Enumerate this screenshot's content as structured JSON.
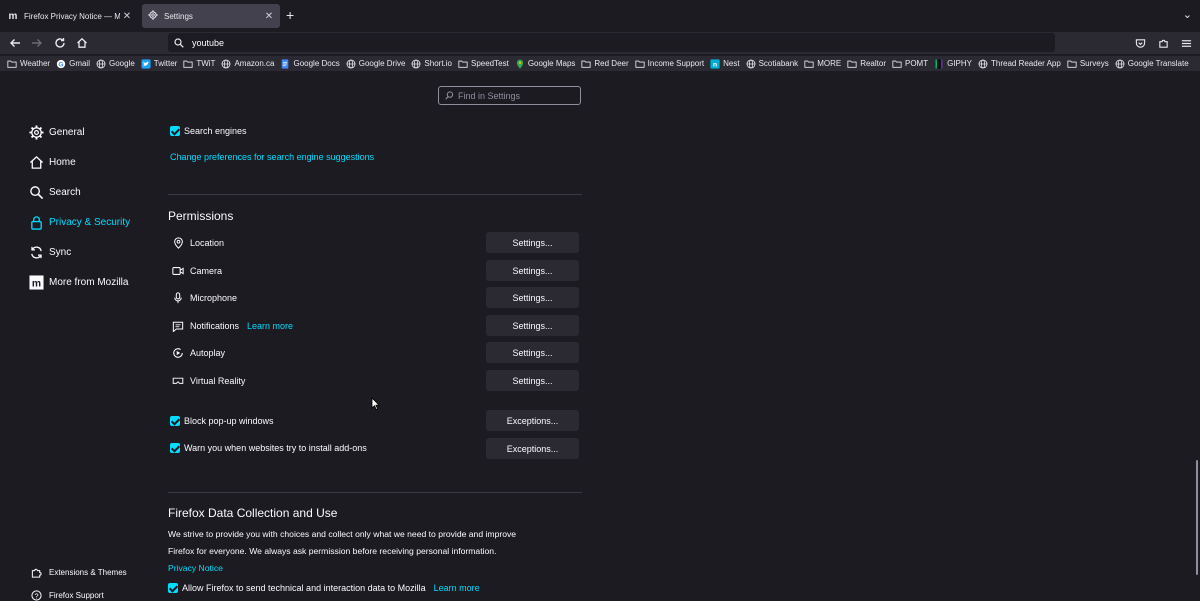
{
  "tabs": [
    {
      "title": "Firefox Privacy Notice — Mozilla",
      "favicon": "m",
      "state": "inactive"
    },
    {
      "title": "Settings",
      "favicon": "gear-icon",
      "state": "active"
    }
  ],
  "nav": {
    "url_text": "youtube"
  },
  "bookmarks": [
    {
      "label": "Weather",
      "icon": "folder-icon"
    },
    {
      "label": "Gmail",
      "icon": "google-icon"
    },
    {
      "label": "Google",
      "icon": "globe-icon"
    },
    {
      "label": "Twitter",
      "icon": "twitter-icon"
    },
    {
      "label": "TWiT",
      "icon": "folder-icon"
    },
    {
      "label": "Amazon.ca",
      "icon": "globe-icon"
    },
    {
      "label": "Google Docs",
      "icon": "docs-icon"
    },
    {
      "label": "Google Drive",
      "icon": "globe-icon"
    },
    {
      "label": "Short.io",
      "icon": "globe-icon"
    },
    {
      "label": "SpeedTest",
      "icon": "folder-icon"
    },
    {
      "label": "Google Maps",
      "icon": "maps-icon"
    },
    {
      "label": "Red Deer",
      "icon": "folder-icon"
    },
    {
      "label": "Income Support",
      "icon": "folder-icon"
    },
    {
      "label": "Nest",
      "icon": "nest-icon"
    },
    {
      "label": "Scotiabank",
      "icon": "globe-icon"
    },
    {
      "label": "MORE",
      "icon": "folder-icon"
    },
    {
      "label": "Realtor",
      "icon": "folder-icon"
    },
    {
      "label": "POMT",
      "icon": "folder-icon"
    },
    {
      "label": "GIPHY",
      "icon": "giphy-icon"
    },
    {
      "label": "Thread Reader App",
      "icon": "globe-icon"
    },
    {
      "label": "Surveys",
      "icon": "folder-icon"
    },
    {
      "label": "Google Translate",
      "icon": "globe-icon"
    }
  ],
  "find": {
    "placeholder": "Find in Settings"
  },
  "categories": [
    {
      "label": "General",
      "icon": "gear-icon"
    },
    {
      "label": "Home",
      "icon": "home-icon"
    },
    {
      "label": "Search",
      "icon": "search-icon"
    },
    {
      "label": "Privacy & Security",
      "icon": "lock-icon",
      "selected": true
    },
    {
      "label": "Sync",
      "icon": "sync-icon"
    },
    {
      "label": "More from Mozilla",
      "icon": "mozilla-icon"
    }
  ],
  "sidebar_footer": {
    "extensions": "Extensions & Themes",
    "support": "Firefox Support"
  },
  "address_bar": {
    "search_engines_label": "Search engines",
    "suggestions_link": "Change preferences for search engine suggestions"
  },
  "permissions": {
    "heading": "Permissions",
    "items": [
      {
        "label": "Location",
        "icon": "location-icon",
        "button": "Settings..."
      },
      {
        "label": "Camera",
        "icon": "camera-icon",
        "button": "Settings..."
      },
      {
        "label": "Microphone",
        "icon": "microphone-icon",
        "button": "Settings..."
      },
      {
        "label": "Notifications",
        "icon": "notification-icon",
        "button": "Settings...",
        "link": "Learn more"
      },
      {
        "label": "Autoplay",
        "icon": "autoplay-icon",
        "button": "Settings..."
      },
      {
        "label": "Virtual Reality",
        "icon": "vr-icon",
        "button": "Settings..."
      }
    ],
    "block_popups": {
      "label": "Block pop-up windows",
      "button": "Exceptions..."
    },
    "warn_addons": {
      "label": "Warn you when websites try to install add-ons",
      "button": "Exceptions..."
    }
  },
  "data_collection": {
    "heading": "Firefox Data Collection and Use",
    "paragraph_line1": "We strive to provide you with choices and collect only what we need to provide and improve",
    "paragraph_line2": "Firefox for everyone. We always ask permission before receiving personal information.",
    "privacy_link": "Privacy Notice",
    "allow_label": "Allow Firefox to send technical and interaction data to Mozilla",
    "learn_more": "Learn more"
  },
  "colors": {
    "accent": "#00ddff",
    "background": "#1c1b22",
    "toolbar": "#2b2a33",
    "button": "#2b2a33"
  }
}
